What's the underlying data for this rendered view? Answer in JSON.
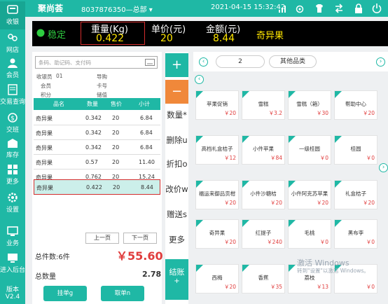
{
  "sidebar": {
    "items": [
      {
        "label": "收银",
        "icon": "cashier-icon"
      },
      {
        "label": "网店",
        "icon": "shop-icon"
      },
      {
        "label": "会员",
        "icon": "member-icon"
      },
      {
        "label": "交易查询",
        "icon": "transaction-search-icon"
      },
      {
        "label": "交班",
        "icon": "handover-icon"
      },
      {
        "label": "库存",
        "icon": "inventory-icon"
      },
      {
        "label": "更多",
        "icon": "more-icon"
      },
      {
        "label": "设置",
        "icon": "settings-icon"
      },
      {
        "label": "业务",
        "icon": "business-icon"
      },
      {
        "label": "进入后台",
        "icon": "backend-icon"
      }
    ],
    "version_label": "版本",
    "version_value": "V2.4"
  },
  "topbar": {
    "logo": "聚尚荟",
    "store": "8037876350—总部 ▾",
    "datetime": "2021-04-15 15:32:42"
  },
  "scale": {
    "status": "稳定",
    "weight_label": "重量(Kg)",
    "weight": "0.422",
    "price_label": "单价(元)",
    "price": "20",
    "amount_label": "金额(元)",
    "amount": "8.44",
    "product": "奇异果"
  },
  "search": {
    "placeholder": "条码、助记码、支付码"
  },
  "info": {
    "cashier_label": "收银员",
    "cashier_value": "01",
    "guide_label": "导购",
    "member_label": "会员",
    "card_label": "卡号",
    "points_label": "积分",
    "stored_label": "储值"
  },
  "table": {
    "headers": [
      "品名",
      "数量",
      "售价",
      "小计"
    ],
    "rows": [
      [
        "奇异果",
        "0.342",
        "20",
        "6.84"
      ],
      [
        "奇异果",
        "0.342",
        "20",
        "6.84"
      ],
      [
        "奇异果",
        "0.342",
        "20",
        "6.84"
      ],
      [
        "奇异果",
        "0.57",
        "20",
        "11.40"
      ],
      [
        "奇异果",
        "0.762",
        "20",
        "15.24"
      ],
      [
        "奇异果",
        "0.422",
        "20",
        "8.44"
      ]
    ]
  },
  "pagination": {
    "prev": "上一页",
    "next": "下一页"
  },
  "totals": {
    "count_label": "总件数:6件",
    "amount": "￥55.60",
    "qty_label": "总数量",
    "qty": "2.78"
  },
  "actions": {
    "hold": "挂单g",
    "retrieve": "取单n"
  },
  "mid": {
    "plus": "+",
    "minus": "−",
    "buttons": [
      "数量*",
      "删除u",
      "折扣o",
      "改价w",
      "赠送s",
      "更多"
    ],
    "checkout": "结账",
    "checkout_sub": "+"
  },
  "categories": {
    "prev": "‹",
    "next": "›",
    "items": [
      "2",
      "其他品类"
    ]
  },
  "nav": {
    "prev": "‹",
    "next": "›"
  },
  "products": [
    {
      "name": "苹果促销",
      "price": "￥20"
    },
    {
      "name": "雪糕",
      "price": "￥3.2"
    },
    {
      "name": "雪糕（箱）",
      "price": "￥30"
    },
    {
      "name": "帮助中心",
      "price": "￥20"
    },
    {
      "name": "高档礼盒桔子",
      "price": "￥12"
    },
    {
      "name": "小件苹果",
      "price": "￥84"
    },
    {
      "name": "一级桂圆",
      "price": "￥0"
    },
    {
      "name": "桂圆",
      "price": "￥0"
    },
    {
      "name": "福运来御品贡柑",
      "price": "￥20"
    },
    {
      "name": "小件沙糖桔",
      "price": "￥20"
    },
    {
      "name": "小件阿克苏苹果",
      "price": "￥20"
    },
    {
      "name": "礼盒桔子",
      "price": "￥20"
    },
    {
      "name": "奇异果",
      "price": "￥20"
    },
    {
      "name": "红提子",
      "price": "￥240"
    },
    {
      "name": "毛桃",
      "price": "￥0"
    },
    {
      "name": "黑布李",
      "price": "￥0"
    },
    {
      "name": "西梅",
      "price": "￥20"
    },
    {
      "name": "香蕉",
      "price": "￥35"
    },
    {
      "name": "荔枝",
      "price": "￥13"
    },
    {
      "name": "",
      "price": "￥0"
    }
  ],
  "watermark": {
    "line1": "激活 Windows",
    "line2": "转到\"设置\"以激活 Windows。"
  },
  "colors": {
    "accent": "#1fb8a5",
    "price_red": "#e03c3c",
    "scale_bg": "#000000",
    "scale_value": "#ffe600"
  }
}
